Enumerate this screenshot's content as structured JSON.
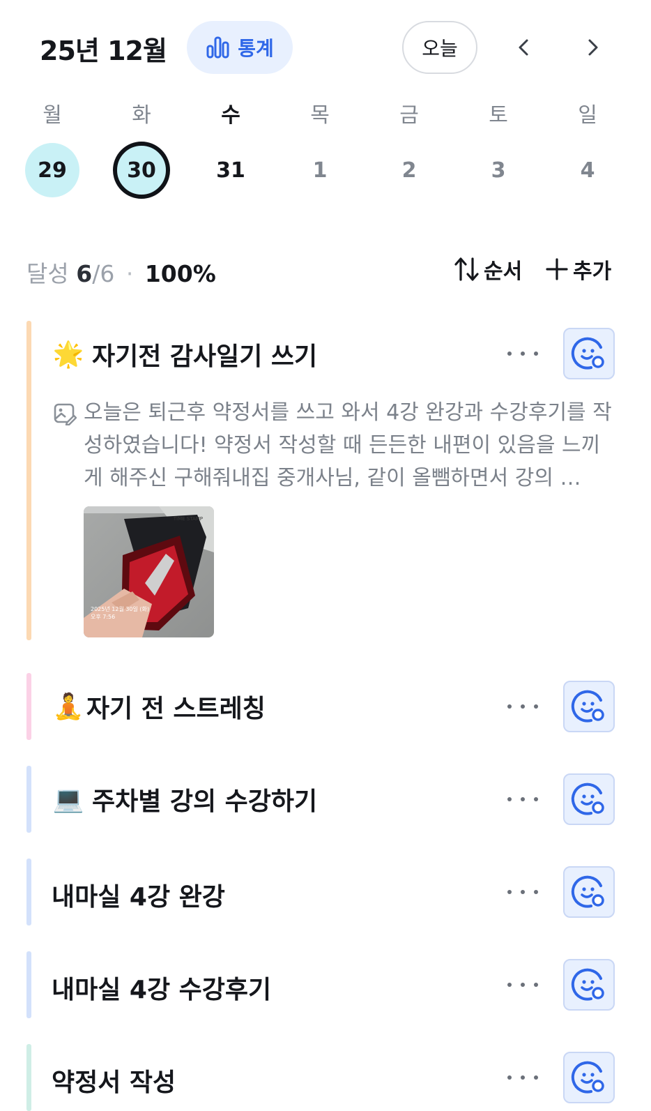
{
  "header": {
    "month_title": "25년 12월",
    "stats_label": "통계",
    "today_label": "오늘"
  },
  "week": {
    "weekdays": [
      "월",
      "화",
      "수",
      "목",
      "금",
      "토",
      "일"
    ],
    "dates": [
      "29",
      "30",
      "31",
      "1",
      "2",
      "3",
      "4"
    ]
  },
  "progress": {
    "label": "달성",
    "done": "6",
    "total": "/6",
    "separator": "·",
    "percent": "100%",
    "sort_label": "순서",
    "add_label": "추가"
  },
  "habits": [
    {
      "emoji": "🌟",
      "title": "자기전 감사일기 쓰기",
      "bar_color": "#fcd9b3",
      "memo": "오늘은 퇴근후 약정서를 쓰고 와서 4강 완강과 수강후기를 작성하였습니다! 약정서 작성할 때 든든한 내편이 있음을 느끼게 해주신 구해줘내집 중개사님, 같이 올뺌하면서 강의 …",
      "photo_stamp_line1": "2025년 12월 30일 (화)",
      "photo_stamp_line2": "오후 7:56",
      "photo_brand": "TIME STAMP"
    },
    {
      "emoji": "🧘",
      "title": "자기 전 스트레칭",
      "bar_color": "#fbd1e6"
    },
    {
      "emoji": "💻",
      "title": "주차별 강의 수강하기",
      "bar_color": "#d3e1fb"
    },
    {
      "emoji": "",
      "title": "내마실 4강 완강",
      "bar_color": "#d3e1fb"
    },
    {
      "emoji": "",
      "title": "내마실 4강 수강후기",
      "bar_color": "#d3e1fb"
    },
    {
      "emoji": "",
      "title": "약정서 작성",
      "bar_color": "#cfeee6"
    }
  ],
  "colors": {
    "accent": "#2f67e8",
    "accent_bg": "#e8f0fe",
    "done_day_bg": "#c9f1f6"
  }
}
